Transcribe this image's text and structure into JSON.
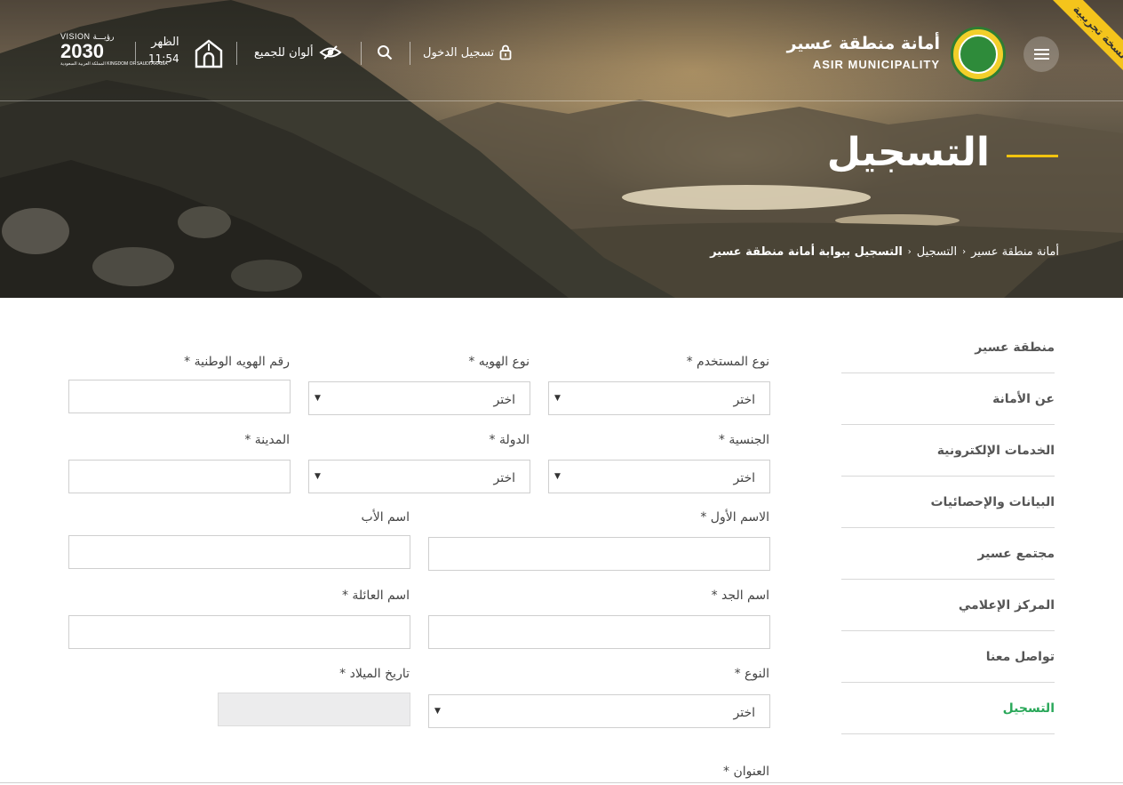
{
  "header": {
    "brand_ar": "أمانة منطقة عسير",
    "brand_en": "ASIR MUNICIPALITY",
    "trial_label": "نسخة تجريبية",
    "login_label": "تسجيل الدخول",
    "colors_label": "ألوان للجميع",
    "prayer_name": "الظهر",
    "prayer_time": "11:54",
    "vision_top": "VISION رؤيـــة",
    "vision_year": "2030",
    "vision_sub": "المملكة العربية السعودية KINGDOM OF SAUDI ARABIA"
  },
  "hero": {
    "title": "التسجيل",
    "breadcrumb": [
      {
        "label": "أمانة منطقة عسير"
      },
      {
        "label": "التسجيل"
      },
      {
        "label": "التسجيل ببوابة أمانة منطقة عسير"
      }
    ]
  },
  "sidebar": {
    "items": [
      {
        "label": "منطقة عسير"
      },
      {
        "label": "عن الأمانة"
      },
      {
        "label": "الخدمات الإلكترونية"
      },
      {
        "label": "البيانات والإحصائيات"
      },
      {
        "label": "مجتمع عسير"
      },
      {
        "label": "المركز الإعلامي"
      },
      {
        "label": "تواصل معنا"
      },
      {
        "label": "التسجيل"
      }
    ]
  },
  "form": {
    "user_type_label": "نوع المستخدم *",
    "id_type_label": "نوع الهويه *",
    "national_id_label": "رقم الهويه الوطنية *",
    "nationality_label": "الجنسية *",
    "country_label": "الدولة *",
    "city_label": "المدينة *",
    "first_name_label": "الاسم الأول *",
    "father_name_label": "اسم الأب",
    "grandfather_name_label": "اسم الجد *",
    "family_name_label": "اسم العائلة *",
    "gender_label": "النوع *",
    "birthdate_label": "تاريخ الميلاد *",
    "address_label": "العنوان *",
    "select_placeholder": "اختر"
  }
}
